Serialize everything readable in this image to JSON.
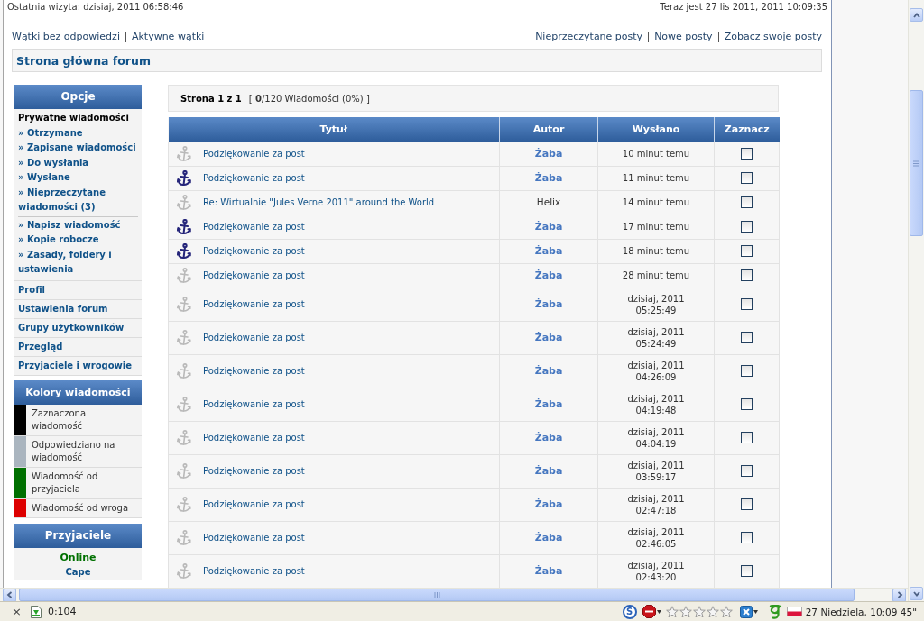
{
  "header": {
    "last_visit": "Ostatnia wizyta: dzisiaj, 2011 06:58:46",
    "current_time": "Teraz jest 27 lis 2011, 2011 10:09:35"
  },
  "quick_links": {
    "left": [
      "Wątki bez odpowiedzi",
      "Aktywne wątki"
    ],
    "right": [
      "Nieprzeczytane posty",
      "Nowe posty",
      "Zobacz swoje posty"
    ]
  },
  "breadcrumb": "Strona główna forum",
  "sidebar": {
    "options": {
      "title": "Opcje",
      "sections": [
        {
          "label": "Prywatne wiadomości",
          "selected": true,
          "groups": [
            [
              "» Otrzymane",
              "» Zapisane wiadomości",
              "» Do wysłania",
              "» Wysłane",
              "» Nieprzeczytane wiadomości (3)"
            ],
            [
              "» Napisz wiadomość",
              "» Kopie robocze",
              "» Zasady, foldery i ustawienia"
            ]
          ]
        },
        {
          "label": "Profil",
          "selected": false
        },
        {
          "label": "Ustawienia forum",
          "selected": false
        },
        {
          "label": "Grupy użytkowników",
          "selected": false
        },
        {
          "label": "Przegląd",
          "selected": false
        },
        {
          "label": "Przyjaciele i wrogowie",
          "selected": false
        }
      ]
    },
    "legend": {
      "title": "Kolory wiadomości",
      "items": [
        {
          "label": "Zaznaczona wiadomość",
          "color": "#000000"
        },
        {
          "label": "Odpowiedziano na wiadomość",
          "color": "#aab5bf"
        },
        {
          "label": "Wiadomość od przyjaciela",
          "color": "#007000"
        },
        {
          "label": "Wiadomość od wroga",
          "color": "#dd0000"
        }
      ]
    },
    "friends": {
      "title": "Przyjaciele",
      "status": "Online",
      "names": [
        "Cape"
      ]
    }
  },
  "pagination": {
    "page": "Strona 1 z 1",
    "summary": "[ **0**/120 Wiadomości (0%) ]"
  },
  "table": {
    "columns": [
      "Tytuł",
      "Autor",
      "Wysłano",
      "Zaznacz"
    ],
    "rows": [
      {
        "unread": false,
        "title": "Podziękowanie za post",
        "author": "Żaba",
        "author_colored": true,
        "sent": "10 minut temu",
        "checked": false
      },
      {
        "unread": true,
        "title": "Podziękowanie za post",
        "author": "Żaba",
        "author_colored": true,
        "sent": "11 minut temu",
        "checked": false
      },
      {
        "unread": false,
        "title": "Re: Wirtualnie \"Jules Verne 2011\" around the World",
        "author": "Helix",
        "author_colored": false,
        "sent": "14 minut temu",
        "checked": false
      },
      {
        "unread": true,
        "title": "Podziękowanie za post",
        "author": "Żaba",
        "author_colored": true,
        "sent": "17 minut temu",
        "checked": false
      },
      {
        "unread": true,
        "title": "Podziękowanie za post",
        "author": "Żaba",
        "author_colored": true,
        "sent": "18 minut temu",
        "checked": false
      },
      {
        "unread": false,
        "title": "Podziękowanie za post",
        "author": "Żaba",
        "author_colored": true,
        "sent": "28 minut temu",
        "checked": false
      },
      {
        "unread": false,
        "title": "Podziękowanie za post",
        "author": "Żaba",
        "author_colored": true,
        "sent": "dzisiaj, 2011 05:25:49",
        "checked": false
      },
      {
        "unread": false,
        "title": "Podziękowanie za post",
        "author": "Żaba",
        "author_colored": true,
        "sent": "dzisiaj, 2011 05:24:49",
        "checked": false
      },
      {
        "unread": false,
        "title": "Podziękowanie za post",
        "author": "Żaba",
        "author_colored": true,
        "sent": "dzisiaj, 2011 04:26:09",
        "checked": false
      },
      {
        "unread": false,
        "title": "Podziękowanie za post",
        "author": "Żaba",
        "author_colored": true,
        "sent": "dzisiaj, 2011 04:19:48",
        "checked": false
      },
      {
        "unread": false,
        "title": "Podziękowanie za post",
        "author": "Żaba",
        "author_colored": true,
        "sent": "dzisiaj, 2011 04:04:19",
        "checked": false
      },
      {
        "unread": false,
        "title": "Podziękowanie za post",
        "author": "Żaba",
        "author_colored": true,
        "sent": "dzisiaj, 2011 03:59:17",
        "checked": false
      },
      {
        "unread": false,
        "title": "Podziękowanie za post",
        "author": "Żaba",
        "author_colored": true,
        "sent": "dzisiaj, 2011 02:47:18",
        "checked": false
      },
      {
        "unread": false,
        "title": "Podziękowanie za post",
        "author": "Żaba",
        "author_colored": true,
        "sent": "dzisiaj, 2011 02:46:05",
        "checked": false
      },
      {
        "unread": false,
        "title": "Podziękowanie za post",
        "author": "Żaba",
        "author_colored": true,
        "sent": "dzisiaj, 2011 02:43:20",
        "checked": false
      }
    ]
  },
  "status_bar": {
    "close": "×",
    "counter": "0:104",
    "addon_letter": "S",
    "rating": {
      "stars": 0
    },
    "clock": "27 Niedziela, 10:09 45\""
  }
}
